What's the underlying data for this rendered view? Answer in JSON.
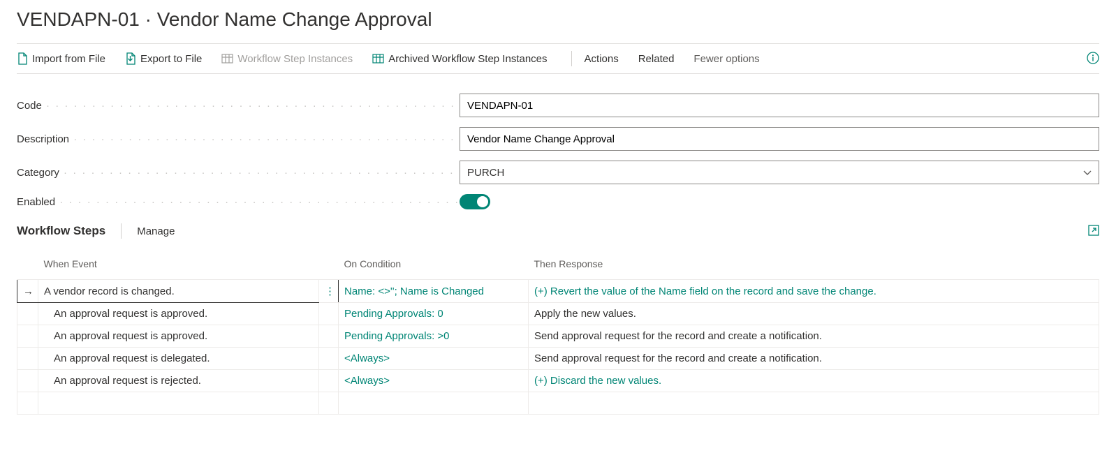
{
  "page_title": "VENDAPN-01 · Vendor Name Change Approval",
  "actions": {
    "import": "Import from File",
    "export": "Export to File",
    "wf_step_instances": "Workflow Step Instances",
    "archived_wf_step_instances": "Archived Workflow Step Instances",
    "actions_menu": "Actions",
    "related": "Related",
    "fewer_options": "Fewer options"
  },
  "fields": {
    "code_label": "Code",
    "code_value": "VENDAPN-01",
    "description_label": "Description",
    "description_value": "Vendor Name Change Approval",
    "category_label": "Category",
    "category_value": "PURCH",
    "enabled_label": "Enabled"
  },
  "section": {
    "title": "Workflow Steps",
    "manage": "Manage"
  },
  "table": {
    "col_event": "When Event",
    "col_condition": "On Condition",
    "col_response": "Then Response",
    "rows": [
      {
        "selected": true,
        "indent": false,
        "event": "A vendor record is changed.",
        "condition": "Name: <>''; Name is Changed",
        "response": "(+) Revert the value of the Name field on the record and save the change.",
        "response_link": true
      },
      {
        "selected": false,
        "indent": true,
        "event": "An approval request is approved.",
        "condition": "Pending Approvals: 0",
        "response": "Apply the new values.",
        "response_link": false
      },
      {
        "selected": false,
        "indent": true,
        "event": "An approval request is approved.",
        "condition": "Pending Approvals: >0",
        "response": "Send approval request for the record and create a notification.",
        "response_link": false
      },
      {
        "selected": false,
        "indent": true,
        "event": "An approval request is delegated.",
        "condition": "<Always>",
        "response": "Send approval request for the record and create a notification.",
        "response_link": false
      },
      {
        "selected": false,
        "indent": true,
        "event": "An approval request is rejected.",
        "condition": "<Always>",
        "response": "(+) Discard the new values.",
        "response_link": true
      }
    ]
  }
}
